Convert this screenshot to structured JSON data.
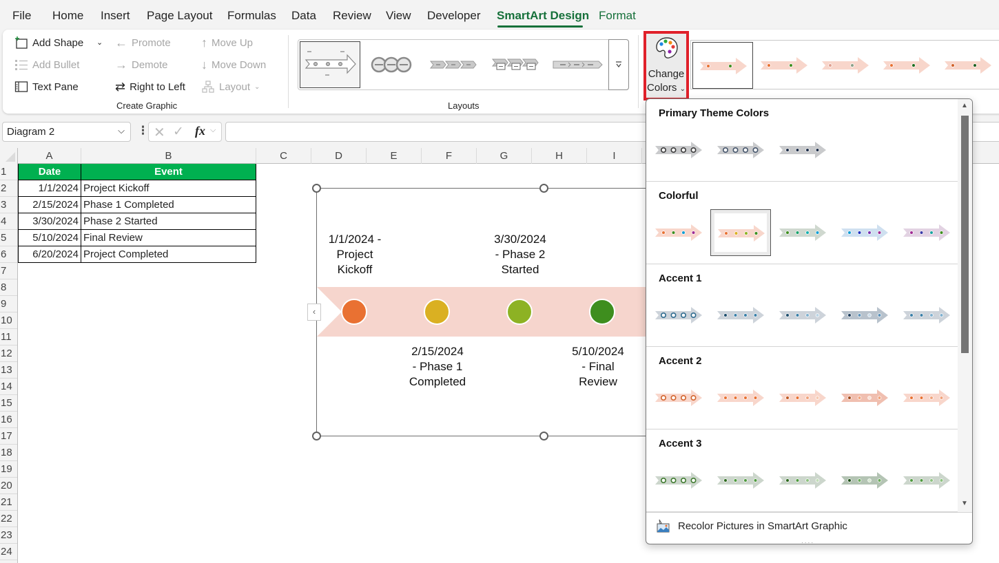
{
  "tabs": [
    {
      "label": "File"
    },
    {
      "label": "Home"
    },
    {
      "label": "Insert"
    },
    {
      "label": "Page Layout"
    },
    {
      "label": "Formulas"
    },
    {
      "label": "Data"
    },
    {
      "label": "Review"
    },
    {
      "label": "View"
    },
    {
      "label": "Developer"
    },
    {
      "label": "SmartArt Design",
      "active": true
    },
    {
      "label": "Format"
    }
  ],
  "ribbon": {
    "create_graphic": {
      "add_shape": "Add Shape",
      "add_bullet": "Add Bullet",
      "text_pane": "Text Pane",
      "promote": "Promote",
      "demote": "Demote",
      "right_to_left": "Right to Left",
      "move_up": "Move Up",
      "move_down": "Move Down",
      "layout": "Layout",
      "group_label": "Create Graphic"
    },
    "layouts": {
      "group_label": "Layouts",
      "items": [
        "Basic Timeline",
        "Circle Accent Timeline",
        "Basic Chevron Process",
        "Accent Process",
        "Continuous Block Process"
      ],
      "selected_index": 0
    },
    "change_colors": {
      "line1": "Change",
      "line2": "Colors"
    },
    "styles_selected_index": 0
  },
  "formula_bar": {
    "name_box": "Diagram 2",
    "fx_label": "fx",
    "formula": ""
  },
  "columns": [
    "A",
    "B",
    "C",
    "D",
    "E",
    "F",
    "G",
    "H",
    "I"
  ],
  "rows": [
    "1",
    "2",
    "3",
    "4",
    "5",
    "6",
    "7",
    "8",
    "9",
    "10",
    "11",
    "12",
    "13",
    "14",
    "15",
    "16",
    "17",
    "18",
    "19",
    "20",
    "21",
    "22",
    "23",
    "24"
  ],
  "table": {
    "headers": [
      "Date",
      "Event"
    ],
    "rows": [
      [
        "1/1/2024",
        "Project Kickoff"
      ],
      [
        "2/15/2024",
        "Phase 1 Completed"
      ],
      [
        "3/30/2024",
        "Phase 2 Started"
      ],
      [
        "5/10/2024",
        "Final Review"
      ],
      [
        "6/20/2024",
        "Project Completed"
      ]
    ],
    "header_color": "#00b050"
  },
  "smartart": {
    "labels_top": [
      {
        "lines": [
          "1/1/2024 -",
          "Project",
          "Kickoff"
        ]
      },
      {
        "lines": [
          "3/30/2024",
          "- Phase 2",
          "Started"
        ]
      }
    ],
    "labels_bottom": [
      {
        "lines": [
          "2/15/2024",
          "- Phase 1",
          "Completed"
        ]
      },
      {
        "lines": [
          "5/10/2024",
          "- Final",
          "Review"
        ]
      }
    ],
    "arrow_color": "#f6d5cd",
    "dot_colors": [
      "#e97132",
      "#dab022",
      "#8db224",
      "#3e8e1e"
    ]
  },
  "colors_dropdown": {
    "sections": [
      {
        "title": "Primary Theme Colors",
        "swatches": [
          {
            "band": "#c9cacc",
            "dots": [
              "#3a3a3a",
              "#3a3a3a",
              "#3a3a3a",
              "#3a3a3a"
            ],
            "ring": true
          },
          {
            "band": "#c9cacc",
            "dots": [
              "#44546a",
              "#44546a",
              "#44546a",
              "#44546a"
            ],
            "ring": true
          },
          {
            "band": "#c9cacc",
            "dots": [
              "#1f2f4a",
              "#1f2f4a",
              "#1f2f4a",
              "#1f2f4a"
            ],
            "ring": false
          }
        ]
      },
      {
        "title": "Colorful",
        "selected_index": 1,
        "swatches": [
          {
            "band": "#f8d6cb",
            "dots": [
              "#e97132",
              "#3e8e1e",
              "#0f9ed5",
              "#a02b93"
            ],
            "ring": false
          },
          {
            "band": "#f8d6cb",
            "dots": [
              "#e97132",
              "#dab022",
              "#8db224",
              "#3e8e1e"
            ],
            "ring": false
          },
          {
            "band": "#cfd8cf",
            "dots": [
              "#3e8e1e",
              "#19a36b",
              "#17b0b0",
              "#0f9ed5"
            ],
            "ring": false
          },
          {
            "band": "#cfe0f0",
            "dots": [
              "#0f9ed5",
              "#2031c0",
              "#7a30b0",
              "#a02b93"
            ],
            "ring": false
          },
          {
            "band": "#e2d2e2",
            "dots": [
              "#a02b93",
              "#3b3aa8",
              "#19a3a0",
              "#3e8e1e"
            ],
            "ring": false
          }
        ]
      },
      {
        "title": "Accent 1",
        "swatches": [
          {
            "band": "#cdd3da",
            "dots": [
              "#2d6a8e",
              "#2d6a8e",
              "#2d6a8e",
              "#2d6a8e"
            ],
            "ring": true
          },
          {
            "band": "#cdd3da",
            "dots": [
              "#1e4e6e",
              "#3a7fa8",
              "#3a7fa8",
              "#3a7fa8"
            ],
            "ring": false
          },
          {
            "band": "#cdd3da",
            "dots": [
              "#1e4e6e",
              "#3a7fa8",
              "#7fb0cf",
              "#b9d3e4"
            ],
            "ring": false
          },
          {
            "band": "#b8c2cc",
            "dots": [
              "#1e3e5e",
              "#5a90b8",
              "#c9dbe8",
              "#5a90b8"
            ],
            "ring": false
          },
          {
            "band": "#cdd3da",
            "dots": [
              "#3a7fa8",
              "#3a7fa8",
              "#7fb0cf",
              "#7fb0cf"
            ],
            "ring": false
          }
        ]
      },
      {
        "title": "Accent 2",
        "swatches": [
          {
            "band": "#f8d6cb",
            "dots": [
              "#d2622a",
              "#d2622a",
              "#d2622a",
              "#d2622a"
            ],
            "ring": true
          },
          {
            "band": "#f8d6cb",
            "dots": [
              "#e97132",
              "#e97132",
              "#e97132",
              "#e97132"
            ],
            "ring": false
          },
          {
            "band": "#f8d6cb",
            "dots": [
              "#c25a24",
              "#e97132",
              "#f0a27a",
              "#f6c8b0"
            ],
            "ring": false
          },
          {
            "band": "#f0bfb0",
            "dots": [
              "#a04a1a",
              "#f0a27a",
              "#fbe0d4",
              "#f0a27a"
            ],
            "ring": false
          },
          {
            "band": "#f8d6cb",
            "dots": [
              "#e97132",
              "#e97132",
              "#f0a27a",
              "#f0a27a"
            ],
            "ring": false
          }
        ]
      },
      {
        "title": "Accent 3",
        "swatches": [
          {
            "band": "#ccd6cc",
            "dots": [
              "#3e7a2e",
              "#3e7a2e",
              "#3e7a2e",
              "#3e7a2e"
            ],
            "ring": true
          },
          {
            "band": "#ccd6cc",
            "dots": [
              "#2d6a1e",
              "#4e9a3e",
              "#4e9a3e",
              "#4e9a3e"
            ],
            "ring": false
          },
          {
            "band": "#ccd6cc",
            "dots": [
              "#2d6a1e",
              "#4e9a3e",
              "#8cc27e",
              "#c0dcb6"
            ],
            "ring": false
          },
          {
            "band": "#b4c4b4",
            "dots": [
              "#1e4e16",
              "#6aaa5a",
              "#d6e8d0",
              "#6aaa5a"
            ],
            "ring": false
          },
          {
            "band": "#ccd6cc",
            "dots": [
              "#4e9a3e",
              "#4e9a3e",
              "#8cc27e",
              "#8cc27e"
            ],
            "ring": false
          }
        ]
      }
    ],
    "footer_item": "Recolor Pictures in SmartArt Graphic"
  },
  "ribbon_style_thumbs": [
    {
      "band": "#f8d6cb",
      "dots": [
        "#e97132",
        "#3e8e1e"
      ]
    },
    {
      "band": "#f8d6cb",
      "dots": [
        "#e97132",
        "#3e8e1e"
      ]
    },
    {
      "band": "#f8d6cb",
      "dots": [
        "#e0a090",
        "#8aa088"
      ]
    },
    {
      "band": "#f8d6cb",
      "dots": [
        "#e97132",
        "#1e6e1e"
      ]
    },
    {
      "band": "#f8d6cb",
      "dots": [
        "#d2622a",
        "#1e5e1e"
      ]
    }
  ]
}
